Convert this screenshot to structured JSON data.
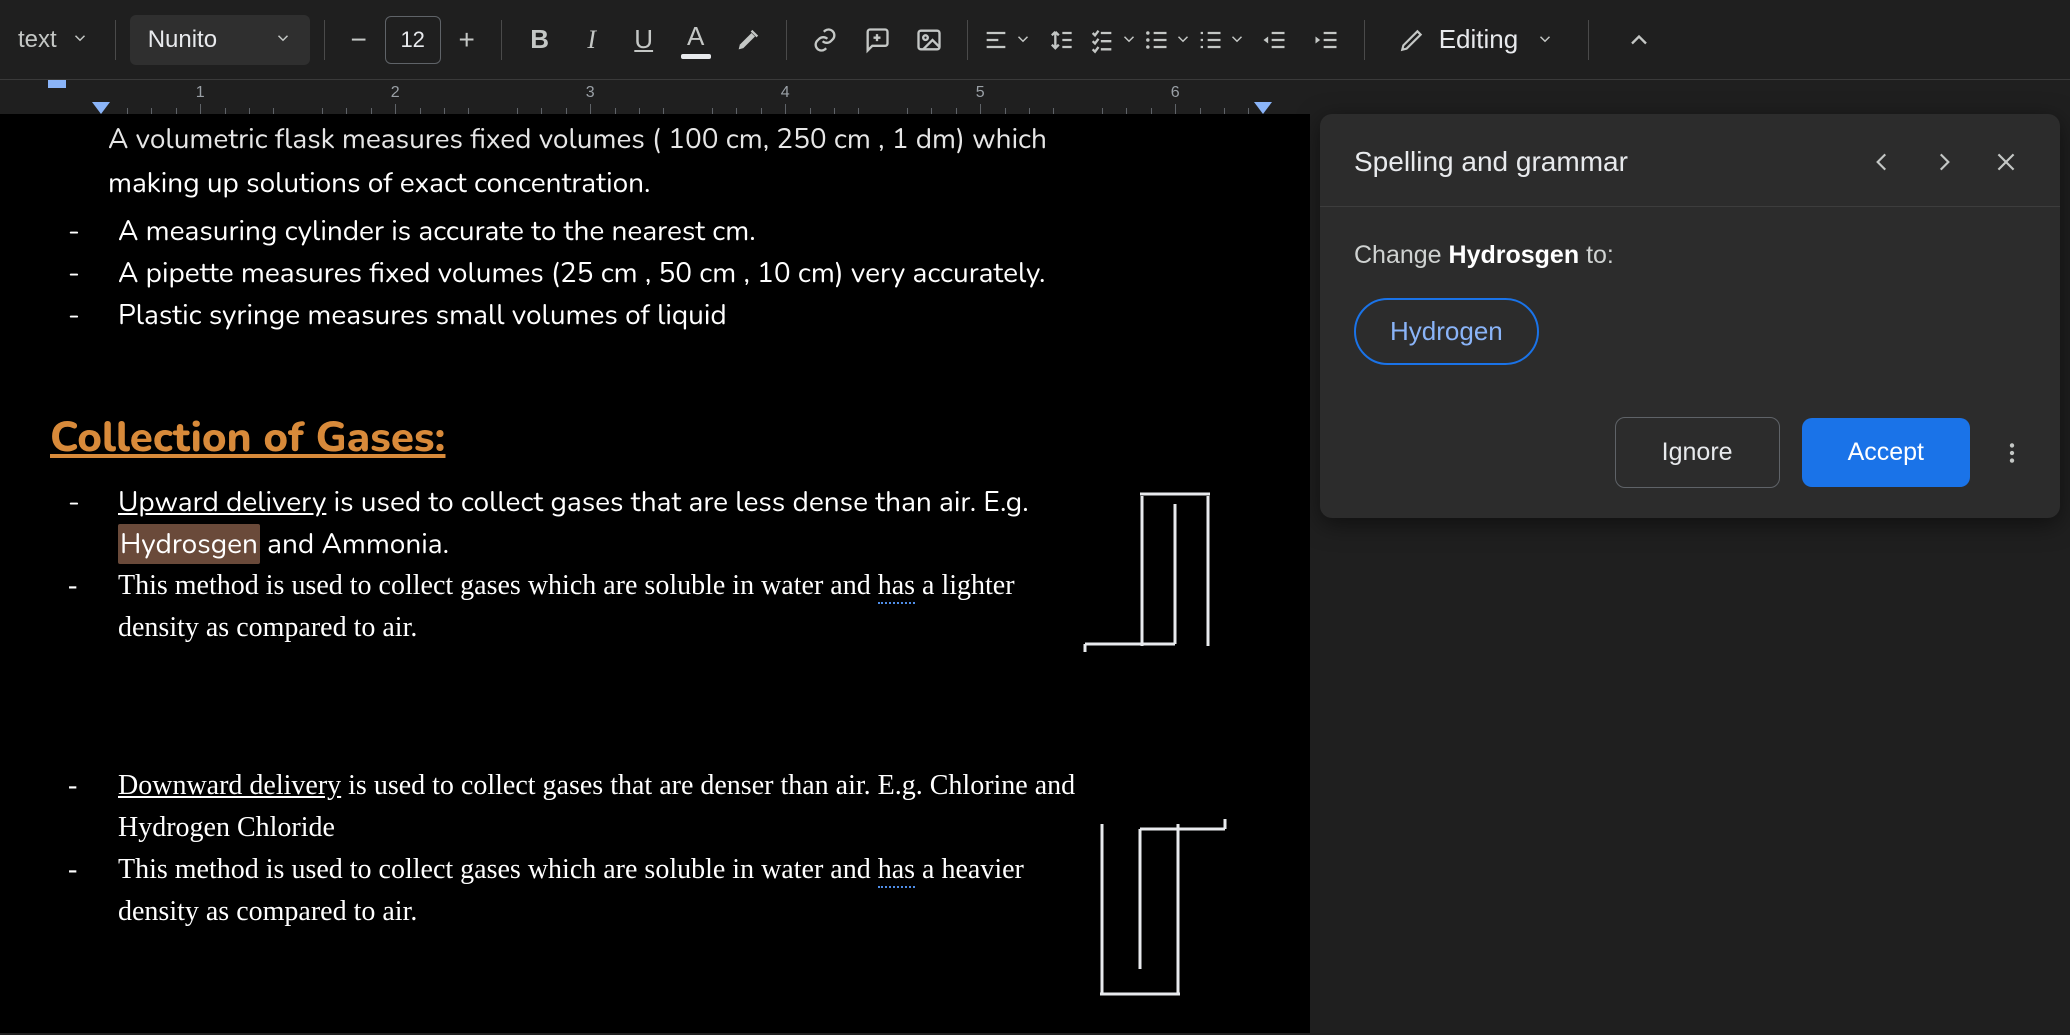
{
  "toolbar": {
    "styles_label": "text",
    "font_name": "Nunito",
    "font_size": "12",
    "editing_label": "Editing"
  },
  "ruler": {
    "numbers": [
      "1",
      "2",
      "3",
      "4",
      "5",
      "6"
    ]
  },
  "doc": {
    "partial_top_line": "A volumetric flask measures fixed volumes ( 100 cm, 250 cm , 1 dm) which",
    "cont_line": "making up solutions of exact concentration.",
    "bullets_top": [
      "A measuring cylinder is accurate to the nearest cm.",
      "A pipette measures fixed volumes (25 cm , 50 cm , 10 cm) very accurately.",
      "Plastic syringe measures small volumes of liquid"
    ],
    "heading": "Collection of Gases:",
    "upward_label": "Upward delivery",
    "upward_rest": " is used to collect gases that are less dense than air. E.g. ",
    "misspelled": "Hydrosgen",
    "upward_tail": " and Ammonia.",
    "upward_line2_a": "This method is used to collect gases which are soluble in water and ",
    "grammar_has1": "has",
    "upward_line2_b": " a lighter density as compared to air.",
    "downward_label": "Downward delivery",
    "downward_rest": " is used to collect gases that are denser than air. E.g. Chlorine and Hydrogen Chloride",
    "downward_line2_a": " This method is used to collect gases which are soluble in water and ",
    "grammar_has2": "has",
    "downward_line2_b": " a heavier density as compared to air."
  },
  "spell": {
    "title": "Spelling and grammar",
    "change_prefix": "Change ",
    "change_word": "Hydrosgen",
    "change_suffix": " to:",
    "suggestion": "Hydrogen",
    "ignore": "Ignore",
    "accept": "Accept"
  }
}
